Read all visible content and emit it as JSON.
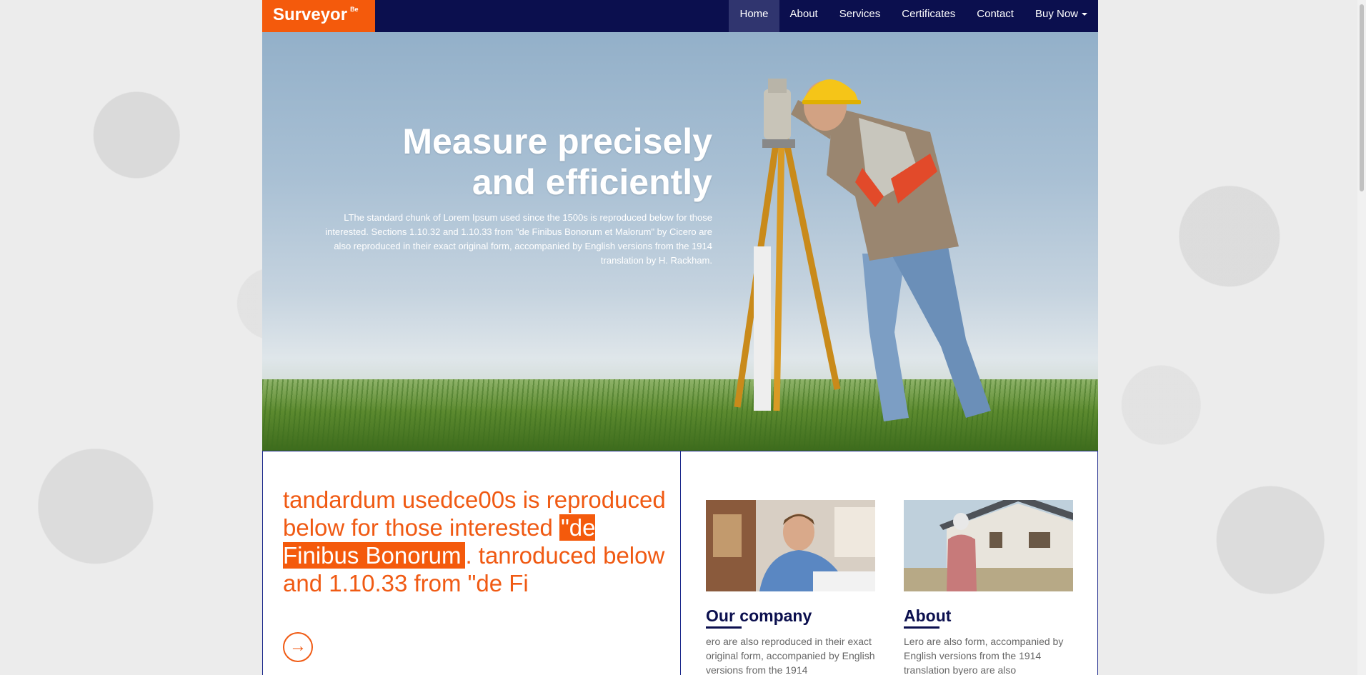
{
  "brand": {
    "name": "Surveyor",
    "badge": "Be"
  },
  "nav": {
    "items": [
      "Home",
      "About",
      "Services",
      "Certificates",
      "Contact"
    ],
    "dropdown_label": "Buy Now"
  },
  "hero": {
    "title_line1": "Measure precisely",
    "title_line2": "and efficiently",
    "text": "LThe standard chunk of Lorem Ipsum used since the 1500s is reproduced below for those interested. Sections 1.10.32 and 1.10.33 from \"de Finibus Bonorum et Malorum\" by Cicero are also reproduced in their exact original form, accompanied by English versions from the 1914 translation by H. Rackham."
  },
  "intro": {
    "text_before": "tandardum usedce00s is reproduced below for those interested ",
    "highlight": "\"de Finibus Bonorum",
    "text_after": ". tanroduced below and 1.10.33 from \"de Fi",
    "button_icon": "arrow-right-icon",
    "button_glyph": "→"
  },
  "cards": [
    {
      "title": "Our company",
      "text": "ero are also reproduced in their exact original form, accompanied by English versions from the 1914"
    },
    {
      "title": "About",
      "text": "Lero are also form, accompanied by English versions from the 1914 translation byero are also"
    }
  ],
  "colors": {
    "navy": "#0b0f4e",
    "orange": "#f45a0c",
    "active_nav": "#30356f"
  }
}
